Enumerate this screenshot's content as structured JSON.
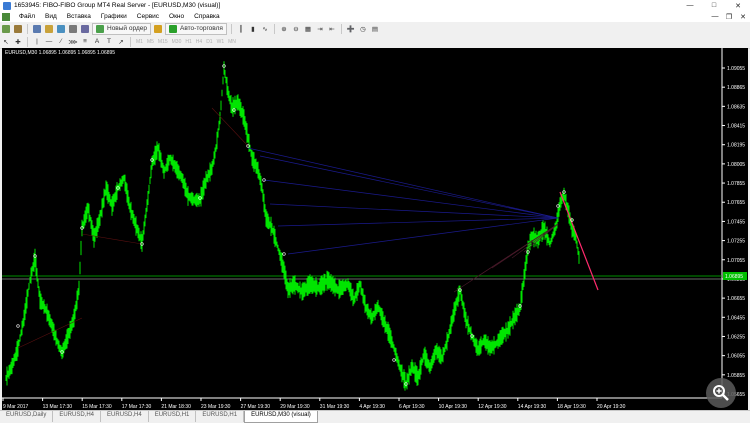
{
  "window": {
    "title": "1653945: FIBO-FIBO Group MT4 Real Server - [EURUSD,M30 (visual)]"
  },
  "menu": [
    "Файл",
    "Вид",
    "Вставка",
    "Графики",
    "Сервис",
    "Окно",
    "Справка"
  ],
  "toolbar": {
    "new_order_label": "Новый ордер",
    "autotrading_label": "Авто-торговля"
  },
  "timeframes": [
    "M1",
    "M5",
    "M15",
    "M30",
    "H1",
    "H4",
    "D1",
    "W1",
    "MN"
  ],
  "chart": {
    "symbol_label": "EURUSD,M30  1.06895 1.06895 1.06895 1.06895",
    "price_labels": [
      "1.09055",
      "1.08865",
      "1.08635",
      "1.08415",
      "1.08195",
      "1.08005",
      "1.07855",
      "1.07655",
      "1.07455",
      "1.07255",
      "1.07055",
      "1.06895",
      "1.06655",
      "1.06455",
      "1.06255",
      "1.06055",
      "1.05855",
      "1.05655"
    ],
    "current_price": "1.06895",
    "current_price_color": "#00c000",
    "time_labels": [
      "9 Mar 2017",
      "13 Mar 17:30",
      "15 Mar 17:30",
      "17 Mar 17:30",
      "21 Mar 18:30",
      "23 Mar 19:30",
      "27 Mar 19:30",
      "29 Mar 19:30",
      "31 Mar 19:30",
      "4 Apr 19:30",
      "6 Apr 19:30",
      "10 Apr 19:30",
      "12 Apr 19:30",
      "14 Apr 19:30",
      "18 Apr 19:30",
      "20 Apr 19:30"
    ],
    "candle_color": "#00ff00",
    "background": "#000000",
    "fan_color": "#1a1a8c",
    "projection_color": "#ff2a6d"
  },
  "tabs": [
    "EURUSD,Daily",
    "EURUSD,H4",
    "EURUSD,H4",
    "EURUSD,H1",
    "EURUSD,H1",
    "EURUSD,M30 (visual)"
  ],
  "active_tab_index": 5
}
